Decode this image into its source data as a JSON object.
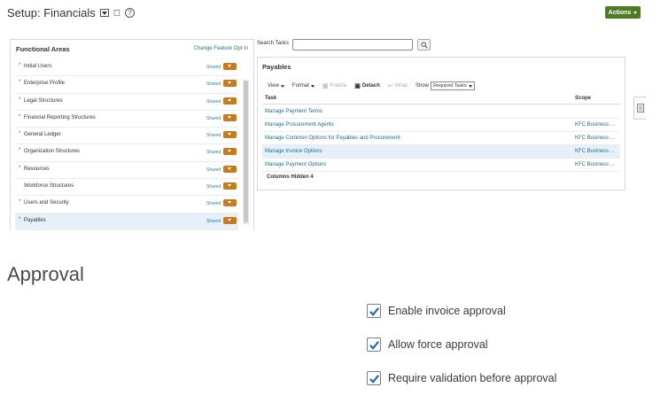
{
  "header": {
    "title": "Setup: Financials",
    "actions_label": "Actions",
    "colors": {
      "actions_bg": "#4f7c20"
    }
  },
  "functional_areas": {
    "title": "Functional Areas",
    "opt_in_link": "Change Feature Opt In",
    "items": [
      {
        "label": "Initial Users",
        "required": true,
        "status": "Shared",
        "selected": false
      },
      {
        "label": "Enterprise Profile",
        "required": true,
        "status": "Shared",
        "selected": false
      },
      {
        "label": "Legal Structures",
        "required": true,
        "status": "Shared",
        "selected": false
      },
      {
        "label": "Financial Reporting Structures",
        "required": true,
        "status": "Shared",
        "selected": false
      },
      {
        "label": "General Ledger",
        "required": true,
        "status": "Shared",
        "selected": false
      },
      {
        "label": "Organization Structures",
        "required": true,
        "status": "Shared",
        "selected": false
      },
      {
        "label": "Resources",
        "required": true,
        "status": "Shared",
        "selected": false
      },
      {
        "label": "Workforce Structures",
        "required": false,
        "status": "Shared",
        "selected": false
      },
      {
        "label": "Users and Security",
        "required": true,
        "status": "Shared",
        "selected": false
      },
      {
        "label": "Payables",
        "required": true,
        "status": "Shared",
        "selected": true
      }
    ],
    "colors": {
      "toggle": "#c87a1e",
      "selected_row": "#e5f0fa"
    }
  },
  "search": {
    "label": "Search Tasks",
    "value": "",
    "placeholder": ""
  },
  "payables": {
    "title": "Payables",
    "toolbar": {
      "view": "View",
      "format": "Format",
      "freeze": "Freeze",
      "detach": "Detach",
      "wrap": "Wrap",
      "show_label": "Show",
      "show_value": "Required Tasks"
    },
    "columns": {
      "task": "Task",
      "scope": "Scope"
    },
    "rows": [
      {
        "task": "Manage Payment Terms",
        "scope": "",
        "selected": false
      },
      {
        "task": "Manage Procurement Agents",
        "scope": "KFC Business ...",
        "selected": false
      },
      {
        "task": "Manage Common Options for Payables and Procurement",
        "scope": "KFC Business ...",
        "selected": false
      },
      {
        "task": "Manage Invoice Options",
        "scope": "KFC Business ...",
        "selected": true
      },
      {
        "task": "Manage Payment Options",
        "scope": "KFC Business ...",
        "selected": false
      }
    ],
    "columns_hidden_label": "Columns Hidden",
    "columns_hidden_count": "4"
  },
  "approval": {
    "title": "Approval",
    "options": [
      {
        "label": "Enable invoice approval",
        "checked": true
      },
      {
        "label": "Allow force approval",
        "checked": true
      },
      {
        "label": "Require validation before approval",
        "checked": true
      }
    ],
    "colors": {
      "check": "#1f6fb5"
    }
  }
}
